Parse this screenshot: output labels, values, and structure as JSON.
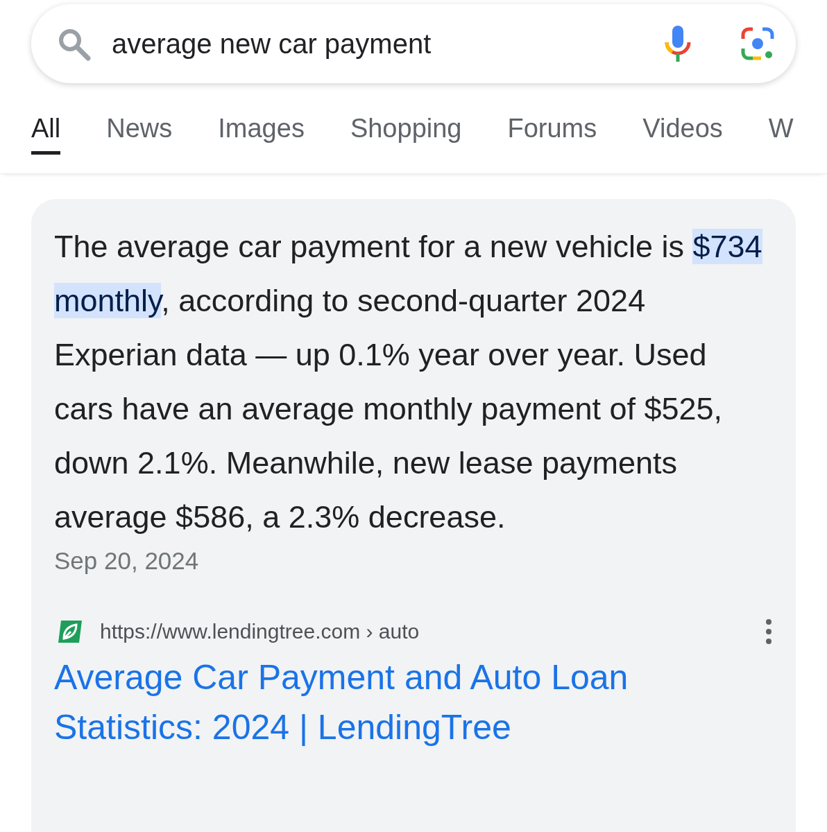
{
  "search": {
    "value": "average new car payment"
  },
  "tabs": [
    {
      "label": "All",
      "selected": true
    },
    {
      "label": "News",
      "selected": false
    },
    {
      "label": "Images",
      "selected": false
    },
    {
      "label": "Shopping",
      "selected": false
    },
    {
      "label": "Forums",
      "selected": false
    },
    {
      "label": "Videos",
      "selected": false
    },
    {
      "label": "W",
      "selected": false
    }
  ],
  "answer": {
    "before": "The average car payment for a new vehicle is ",
    "highlight": "$734 monthly",
    "after": ", according to second-quarter 2024 Experian data — up 0.1% year over year. Used cars have an average monthly payment of $525, down 2.1%. Meanwhile, new lease payments average $586, a 2.3% decrease.",
    "date": "Sep 20, 2024"
  },
  "source": {
    "url": "https://www.lendingtree.com › auto",
    "title": "Average Car Payment and Auto Loan Statistics: 2024 | LendingTree"
  }
}
